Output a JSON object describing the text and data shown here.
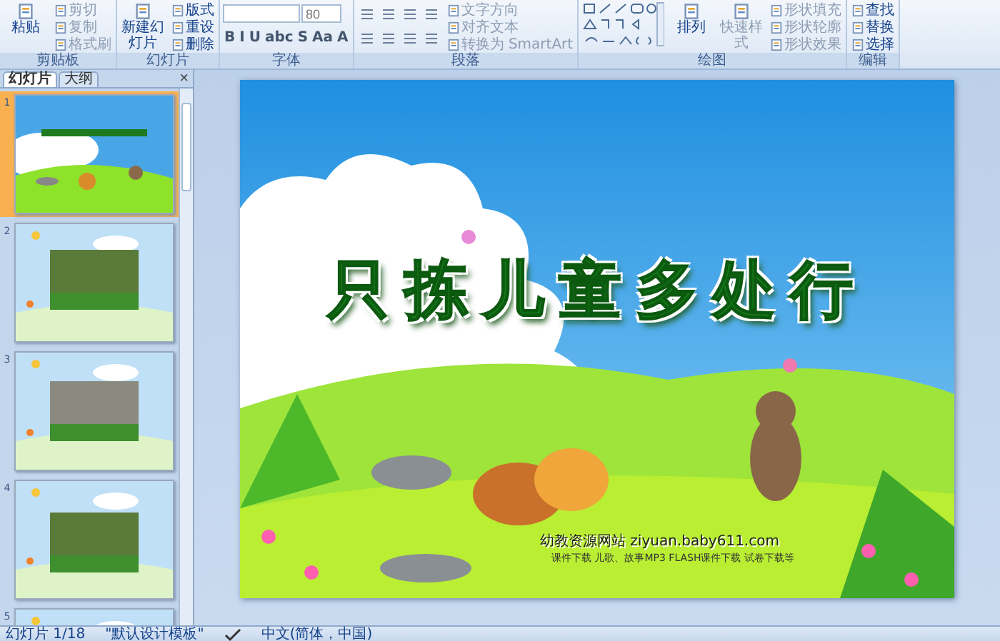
{
  "ribbon": {
    "groups": [
      {
        "label": "剪贴板",
        "kind": "buttons",
        "buttons": [
          {
            "label": "粘贴",
            "kind": "large",
            "disabled": false
          },
          {
            "label": "剪切",
            "kind": "small",
            "disabled": true
          },
          {
            "label": "复制",
            "kind": "small",
            "disabled": true
          },
          {
            "label": "格式刷",
            "kind": "small",
            "disabled": true
          }
        ]
      },
      {
        "label": "幻灯片",
        "kind": "buttons",
        "buttons": [
          {
            "label": "新建幻灯片",
            "kind": "large",
            "disabled": false
          },
          {
            "label": "版式",
            "kind": "small",
            "disabled": false
          },
          {
            "label": "重设",
            "kind": "small",
            "disabled": false
          },
          {
            "label": "删除",
            "kind": "small",
            "disabled": false
          }
        ]
      },
      {
        "label": "字体",
        "kind": "font",
        "font_size": "80",
        "format_buttons": [
          "B",
          "I",
          "U",
          "abc",
          "S",
          "Aa",
          "A"
        ]
      },
      {
        "label": "段落",
        "kind": "paragraph",
        "buttons": [
          {
            "label": "文字方向",
            "kind": "small",
            "disabled": true
          },
          {
            "label": "对齐文本",
            "kind": "small",
            "disabled": true
          },
          {
            "label": "转换为 SmartArt",
            "kind": "small",
            "disabled": true
          }
        ]
      },
      {
        "label": "绘图",
        "kind": "drawing",
        "buttons": [
          {
            "label": "排列",
            "kind": "large",
            "disabled": false
          },
          {
            "label": "快速样式",
            "kind": "large",
            "disabled": true
          },
          {
            "label": "形状填充",
            "kind": "small",
            "disabled": true
          },
          {
            "label": "形状轮廓",
            "kind": "small",
            "disabled": true
          },
          {
            "label": "形状效果",
            "kind": "small",
            "disabled": true
          }
        ]
      },
      {
        "label": "编辑",
        "kind": "buttons",
        "buttons": [
          {
            "label": "查找",
            "kind": "small",
            "disabled": false
          },
          {
            "label": "替换",
            "kind": "small",
            "disabled": false
          },
          {
            "label": "选择",
            "kind": "small",
            "disabled": false
          }
        ]
      }
    ]
  },
  "pane": {
    "tabs": [
      {
        "label": "幻灯片",
        "selected": true
      },
      {
        "label": "大纲",
        "selected": false
      }
    ],
    "close": "×",
    "slides": [
      {
        "number": "1",
        "selected": true,
        "kind": "title"
      },
      {
        "number": "2",
        "selected": false
      },
      {
        "number": "3",
        "selected": false
      },
      {
        "number": "4",
        "selected": false
      },
      {
        "number": "5",
        "selected": false
      }
    ]
  },
  "slide": {
    "title": "只拣儿童多处行",
    "site": "幼教资源网站  ziyuan.baby611.com",
    "links": "课件下载  儿歌、故事MP3  FLASH课件下载  试卷下载等"
  },
  "status_bar": {
    "slide_count": "幻灯片 1/18",
    "theme": "\"默认设计模板\"",
    "language": "中文(简体，中国)"
  }
}
